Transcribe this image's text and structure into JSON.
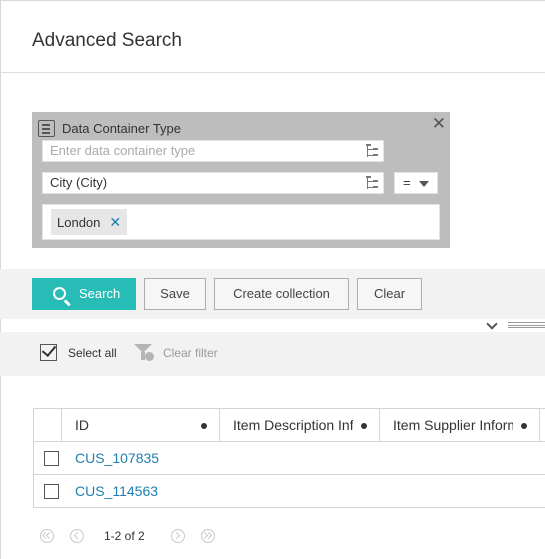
{
  "header": {
    "title": "Advanced Search"
  },
  "criteria": {
    "title": "Data Container Type",
    "container_type_placeholder": "Enter data container type",
    "attribute_value": "City (City)",
    "operator": "=",
    "chips": [
      "London"
    ]
  },
  "toolbar": {
    "search_label": "Search",
    "save_label": "Save",
    "create_collection_label": "Create collection",
    "clear_label": "Clear",
    "accent_color": "#27bdb6"
  },
  "actions": {
    "select_all_label": "Select all",
    "clear_filter_label": "Clear filter"
  },
  "table": {
    "columns": [
      "ID",
      "Item Description Information",
      "Item Supplier Information"
    ],
    "rows": [
      {
        "id": "CUS_107835"
      },
      {
        "id": "CUS_114563"
      }
    ]
  },
  "pagination": {
    "info": "1-2 of 2"
  }
}
